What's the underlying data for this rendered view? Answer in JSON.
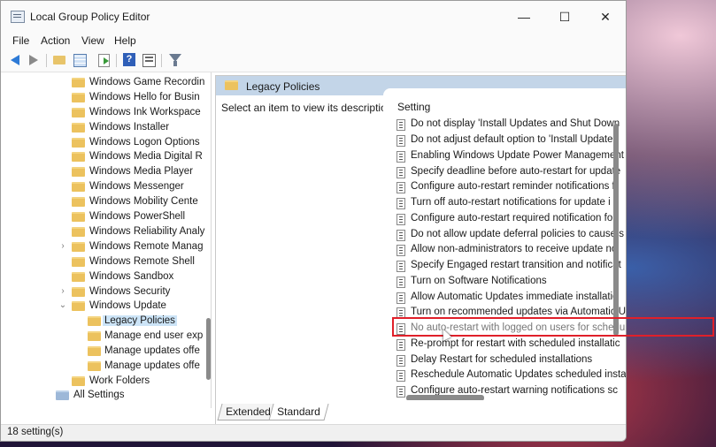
{
  "window": {
    "title": "Local Group Policy Editor"
  },
  "menu": [
    "File",
    "Action",
    "View",
    "Help"
  ],
  "toolbar": [
    "back-icon",
    "forward-icon",
    "up-folder-icon",
    "show-hide-tree-icon",
    "export-list-icon",
    "help-icon",
    "view-icon",
    "filter-icon"
  ],
  "tree": {
    "items": [
      {
        "label": "Windows Game Recordin",
        "expander": ""
      },
      {
        "label": "Windows Hello for Busin",
        "expander": ""
      },
      {
        "label": "Windows Ink Workspace",
        "expander": ""
      },
      {
        "label": "Windows Installer",
        "expander": ""
      },
      {
        "label": "Windows Logon Options",
        "expander": ""
      },
      {
        "label": "Windows Media Digital R",
        "expander": ""
      },
      {
        "label": "Windows Media Player",
        "expander": ""
      },
      {
        "label": "Windows Messenger",
        "expander": ""
      },
      {
        "label": "Windows Mobility Cente",
        "expander": ""
      },
      {
        "label": "Windows PowerShell",
        "expander": ""
      },
      {
        "label": "Windows Reliability Analy",
        "expander": ""
      },
      {
        "label": "Windows Remote Manag",
        "expander": "›"
      },
      {
        "label": "Windows Remote Shell",
        "expander": ""
      },
      {
        "label": "Windows Sandbox",
        "expander": ""
      },
      {
        "label": "Windows Security",
        "expander": "›"
      },
      {
        "label": "Windows Update",
        "expander": "⌄"
      },
      {
        "label": "Legacy Policies",
        "expander": "",
        "selected": true
      },
      {
        "label": "Manage end user exp",
        "expander": ""
      },
      {
        "label": "Manage updates offe",
        "expander": ""
      },
      {
        "label": "Manage updates offe",
        "expander": ""
      },
      {
        "label": "Work Folders",
        "expander": ""
      },
      {
        "label": "All Settings",
        "expander": ""
      }
    ]
  },
  "details": {
    "header": "Legacy Policies",
    "description": "Select an item to view its description.",
    "column": "Setting",
    "settings": [
      "Do not display 'Install Updates and Shut Down",
      "Do not adjust default option to 'Install Update",
      "Enabling Windows Update Power Management",
      "Specify deadline before auto-restart for update",
      "Configure auto-restart reminder notifications f",
      "Turn off auto-restart notifications for update i",
      "Configure auto-restart required notification fo",
      "Do not allow update deferral policies to cause s",
      "Allow non-administrators to receive update no",
      "Specify Engaged restart transition and notificat",
      "Turn on Software Notifications",
      "Allow Automatic Updates immediate installatio",
      "Turn on recommended updates via Automatic U",
      "No auto-restart with logged on users for scheduled automatic updates",
      "Re-prompt for restart with scheduled installatic",
      "Delay Restart for scheduled installations",
      "Reschedule Automatic Updates scheduled insta",
      "Configure auto-restart warning notifications sc"
    ],
    "tabs": [
      "Extended",
      "Standard"
    ]
  },
  "status": {
    "text": "18 setting(s)"
  }
}
